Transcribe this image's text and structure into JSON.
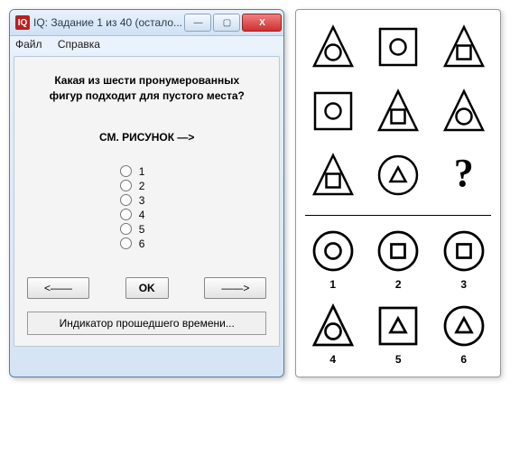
{
  "window": {
    "icon_text": "IQ",
    "title": "IQ: Задание 1 из 40  (остало...",
    "btn_min": "—",
    "btn_max": "▢",
    "btn_close": "X"
  },
  "menu": {
    "file": "Файл",
    "help": "Справка"
  },
  "content": {
    "question_l1": "Какая из шести пронумерованных",
    "question_l2": "фигур подходит для пустого места?",
    "see_pic": "СМ. РИСУНОК  —>",
    "options": [
      "1",
      "2",
      "3",
      "4",
      "5",
      "6"
    ],
    "btn_prev": "<——",
    "btn_ok": "OK",
    "btn_next": "——>",
    "timer": "Индикатор прошедшего времени..."
  },
  "puzzle": {
    "grid": [
      {
        "outer": "triangle",
        "inner": "circle"
      },
      {
        "outer": "square",
        "inner": "circle"
      },
      {
        "outer": "triangle",
        "inner": "square"
      },
      {
        "outer": "square",
        "inner": "circle"
      },
      {
        "outer": "triangle",
        "inner": "square"
      },
      {
        "outer": "triangle",
        "inner": "circle"
      },
      {
        "outer": "triangle",
        "inner": "square"
      },
      {
        "outer": "circle",
        "inner": "triangle"
      },
      {
        "missing": true
      }
    ],
    "answers": [
      {
        "outer": "circle",
        "inner": "circle",
        "label": "1"
      },
      {
        "outer": "circle",
        "inner": "square",
        "label": "2"
      },
      {
        "outer": "circle",
        "inner": "square",
        "label": "3"
      },
      {
        "outer": "triangle",
        "inner": "circle",
        "label": "4"
      },
      {
        "outer": "square",
        "inner": "triangle",
        "label": "5"
      },
      {
        "outer": "circle",
        "inner": "triangle",
        "label": "6"
      }
    ]
  }
}
